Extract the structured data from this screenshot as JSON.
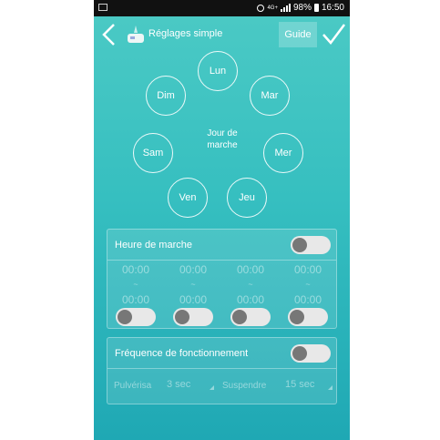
{
  "status_bar": {
    "network": "4G+",
    "battery": "98%",
    "time": "16:50"
  },
  "header": {
    "title": "Réglages simple",
    "guide_label": "Guide"
  },
  "days": {
    "mon": "Lun",
    "tue": "Mar",
    "wed": "Mer",
    "thu": "Jeu",
    "fri": "Ven",
    "sat": "Sam",
    "sun": "Dim"
  },
  "center_label_line1": "Jour de",
  "center_label_line2": "marche",
  "run_time": {
    "label": "Heure de marche",
    "slots": [
      {
        "start": "00:00",
        "separator": "~",
        "end": "00:00"
      },
      {
        "start": "00:00",
        "separator": "~",
        "end": "00:00"
      },
      {
        "start": "00:00",
        "separator": "~",
        "end": "00:00"
      },
      {
        "start": "00:00",
        "separator": "~",
        "end": "00:00"
      }
    ]
  },
  "frequency": {
    "label": "Fréquence de fonctionnement",
    "spray_label": "Pulvérisa",
    "spray_value": "3 sec",
    "pause_label": "Suspendre",
    "pause_value": "15 sec"
  },
  "colors": {
    "background_top": "#4ccac5",
    "background_bottom": "#1fa8b4",
    "toggle_track": "#e8e8e8",
    "toggle_knob": "#777777"
  }
}
